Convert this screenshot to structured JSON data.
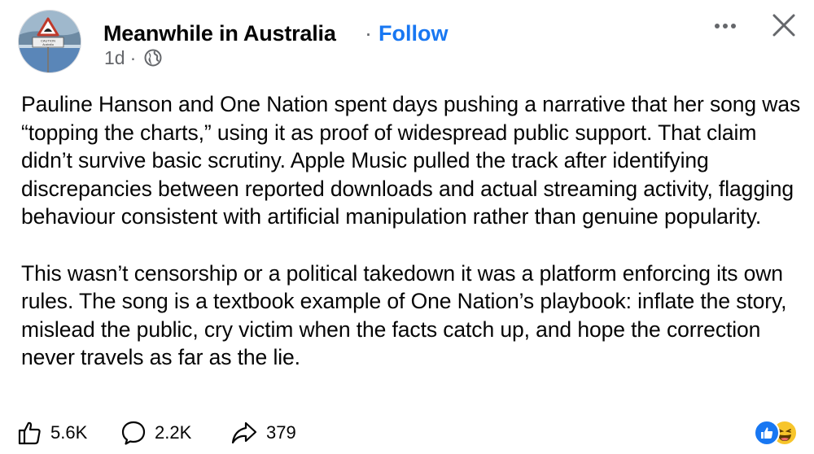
{
  "post": {
    "author": "Meanwhile in Australia",
    "separator": "·",
    "follow_label": "Follow",
    "timestamp": "1d",
    "meta_separator": "·",
    "audience_icon": "globe-icon",
    "avatar_sign_text": "CAUTION\nAustralia",
    "paragraphs": [
      "Pauline Hanson and One Nation spent days pushing a narrative that her song was “topping the charts,” using it as proof of widespread public support. That claim didn’t survive basic scrutiny. Apple Music pulled the track after identifying discrepancies between reported downloads and actual streaming activity, flagging behaviour consistent with artificial manipulation rather than genuine popularity.",
      "This wasn’t censorship or a political takedown it was a platform enforcing its own rules. The song is a textbook example of One Nation’s playbook: inflate the story, mislead the public, cry victim when the facts catch up, and hope the correction never travels as far as the lie."
    ]
  },
  "actions": {
    "like_count": "5.6K",
    "comment_count": "2.2K",
    "share_count": "379"
  },
  "icons": {
    "more": "more-icon",
    "close": "close-icon",
    "like": "thumbs-up-icon",
    "comment": "comment-bubble-icon",
    "share": "share-arrow-icon",
    "reactions": [
      "like-reaction-icon",
      "haha-reaction-icon"
    ]
  },
  "colors": {
    "link": "#1877f2",
    "secondary_text": "#65676b",
    "text": "#050505",
    "like_reaction": "#1877f2",
    "haha_reaction": "#f7c52b"
  }
}
